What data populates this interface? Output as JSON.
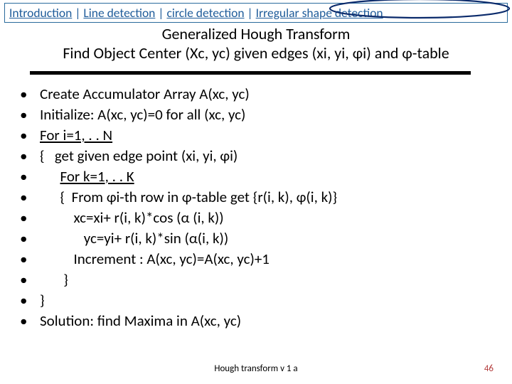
{
  "nav": {
    "items": [
      {
        "label": "Introduction"
      },
      {
        "label": "Line detection"
      },
      {
        "label": "circle detection"
      },
      {
        "label": "Irregular shape detection"
      }
    ],
    "separator": " | "
  },
  "title": {
    "line1": "Generalized Hough Transform",
    "line2": "Find Object Center (Xc, yc) given edges (xi, yi, φi) and φ-table"
  },
  "body": {
    "lines": [
      {
        "text": "Create Accumulator Array A(xc, yc)"
      },
      {
        "text": "Initialize: A(xc, yc)=0 for all (xc, yc)"
      },
      {
        "pre": "",
        "under": "For i=1, . . N"
      },
      {
        "text": "{   get given edge point (xi, yi, φi)"
      },
      {
        "pre": "      ",
        "under": "For k=1, . . K"
      },
      {
        "text": "      {  From φi-th row in φ-table get {r(i, k), φ(i, k)}"
      },
      {
        "text": "          xc=xi+ r(i, k)*cos (α (i, k))"
      },
      {
        "text": "             yc=yi+ r(i, k)*sin (α(i, k))"
      },
      {
        "text": "          Increment : A(xc, yc)=A(xc, yc)+1"
      },
      {
        "text": "       }"
      },
      {
        "text": "}"
      },
      {
        "text": "Solution: find Maxima in A(xc, yc)"
      }
    ]
  },
  "footer": {
    "center": "Hough  transform  v 1 a",
    "page": "46"
  }
}
